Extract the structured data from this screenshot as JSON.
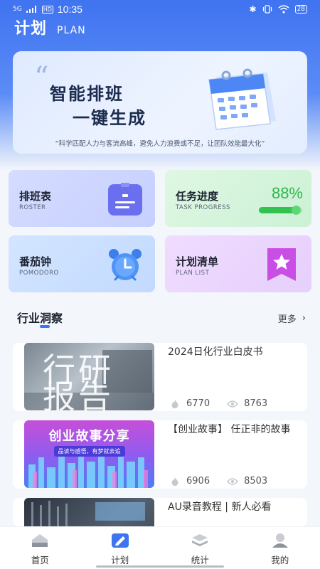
{
  "status_bar": {
    "signal": "5G",
    "hd": "HD",
    "time": "10:35",
    "battery": "28"
  },
  "header": {
    "title": "计划",
    "subtitle": "PLAN"
  },
  "banner": {
    "line1": "智能排班",
    "line2": "一键生成",
    "tagline": "“科学匹配人力与客流高峰，避免人力浪费或不足，让团队效能最大化”"
  },
  "features": {
    "roster": {
      "title": "排班表",
      "subtitle": "ROSTER",
      "icon": "clipboard-icon"
    },
    "task": {
      "title": "任务进度",
      "subtitle": "TASK PROGRESS",
      "percent_label": "88%",
      "progress": 0.88
    },
    "pomodoro": {
      "title": "番茄钟",
      "subtitle": "POMODORO",
      "icon": "alarm-clock-icon"
    },
    "plan": {
      "title": "计划清单",
      "subtitle": "PLAN LIST",
      "icon": "star-bookmark-icon"
    }
  },
  "insights": {
    "title": "行业洞察",
    "more": "更多"
  },
  "articles": [
    {
      "title": "2024日化行业白皮书",
      "thumb_text_top": "行研",
      "thumb_text_bottom": "报告",
      "hot": "6770",
      "views": "8763"
    },
    {
      "title": "【创业故事】 任正非的故事",
      "thumb_title": "创业故事分享",
      "thumb_sub": "品读与感悟，有梦就去追",
      "hot": "6906",
      "views": "8503"
    },
    {
      "title": "AU录音教程 | 新人必看"
    }
  ],
  "tabs": [
    {
      "label": "首页",
      "icon": "home-icon"
    },
    {
      "label": "计划",
      "icon": "plan-icon"
    },
    {
      "label": "统计",
      "icon": "stack-icon"
    },
    {
      "label": "我的",
      "icon": "user-icon"
    }
  ],
  "colors": {
    "primary": "#3f73f0",
    "progress": "#34c24f",
    "tab_active": "#3f73f0"
  }
}
